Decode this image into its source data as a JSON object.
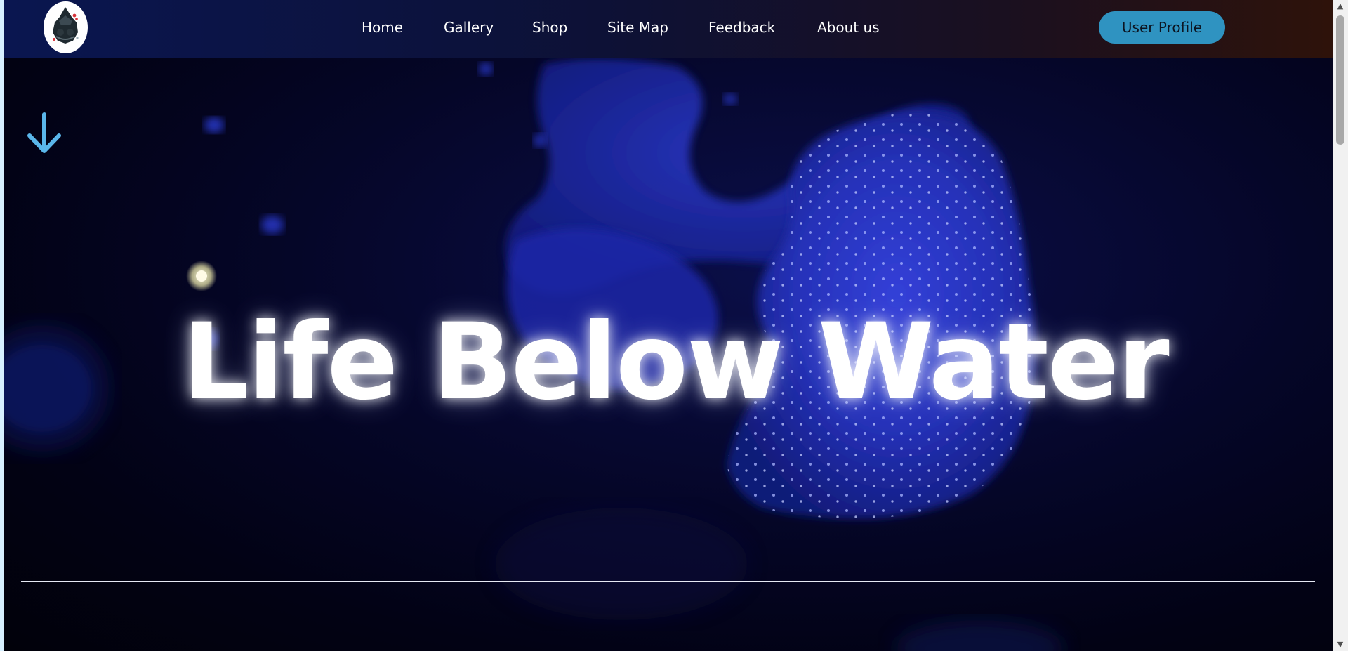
{
  "nav": {
    "logo": "site-logo",
    "links": [
      "Home",
      "Gallery",
      "Shop",
      "Site Map",
      "Feedback",
      "About us"
    ],
    "profile_label": "User Profile"
  },
  "hero": {
    "title": "Life Below Water",
    "scroll_icon": "arrow-down-icon"
  },
  "colors": {
    "profile_button": "#2f93c1",
    "arrow": "#5ab6ea",
    "nav_gradient_start": "#0a1650",
    "nav_gradient_end": "#2e120a"
  },
  "scrollbar": {
    "up_icon": "scroll-up-icon",
    "down_icon": "scroll-down-icon"
  }
}
